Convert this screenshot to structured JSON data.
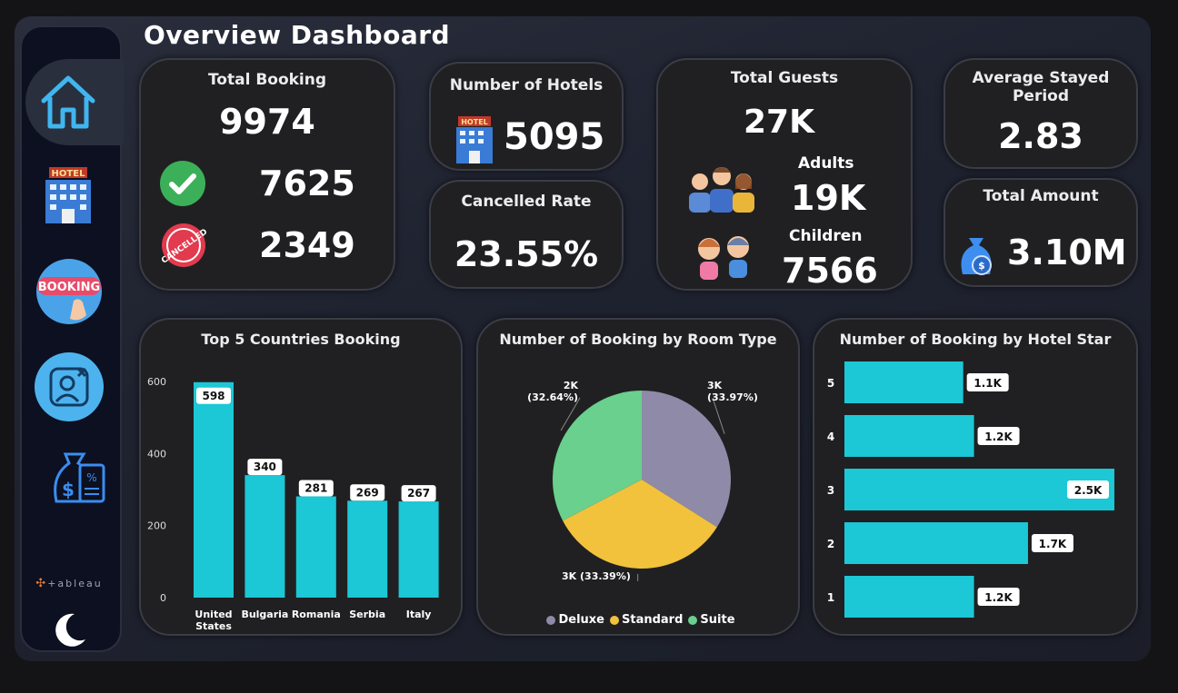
{
  "page_title": "Overview Dashboard",
  "sidebar": {
    "items": [
      {
        "name": "home",
        "icon": "home-icon"
      },
      {
        "name": "hotel",
        "icon": "hotel-icon",
        "label": "HOTEL"
      },
      {
        "name": "booking",
        "icon": "booking-icon",
        "label": "BOOKING"
      },
      {
        "name": "guest",
        "icon": "guest-cancel-icon"
      },
      {
        "name": "finance",
        "icon": "money-bag-receipt-icon"
      }
    ],
    "tableau_label": "+ableau",
    "theme_icon": "moon-icon"
  },
  "kpis": {
    "total_booking": {
      "title": "Total Booking",
      "value": "9974",
      "confirmed": "7625",
      "cancelled": "2349",
      "cancelled_stamp": "CANCELLED"
    },
    "hotels": {
      "title": "Number of Hotels",
      "value": "5095",
      "icon_label": "HOTEL"
    },
    "cancelled_rate": {
      "title": "Cancelled Rate",
      "value": "23.55%"
    },
    "guests": {
      "title": "Total Guests",
      "value": "27K",
      "adults_label": "Adults",
      "adults_value": "19K",
      "children_label": "Children",
      "children_value": "7566"
    },
    "avg_stay": {
      "title": "Average Stayed Period",
      "value": "2.83"
    },
    "total_amount": {
      "title": "Total Amount",
      "value": "3.10M"
    }
  },
  "colors": {
    "accent": "#1cc7d6",
    "deluxe": "#8e8aa8",
    "standard": "#f2c23c",
    "suite": "#69d08d",
    "card": "#202022"
  },
  "chart_data": [
    {
      "type": "bar",
      "title": "Top 5 Countries Booking",
      "categories": [
        "United States",
        "Bulgaria",
        "Romania",
        "Serbia",
        "Italy"
      ],
      "values": [
        598,
        340,
        281,
        269,
        267
      ],
      "ylim": [
        0,
        600
      ],
      "yticks": [
        "0",
        "200",
        "400",
        "600"
      ],
      "grid": false
    },
    {
      "type": "pie",
      "title": "Number of Booking by Room Type",
      "slices": [
        {
          "name": "Deluxe",
          "label": "3K",
          "pct": 33.97,
          "pct_label": "(33.97%)"
        },
        {
          "name": "Standard",
          "label": "3K",
          "pct": 33.39,
          "pct_label": "(33.39%)"
        },
        {
          "name": "Suite",
          "label": "2K",
          "pct": 32.64,
          "pct_label": "(32.64%)"
        }
      ],
      "legend": "bottom"
    },
    {
      "type": "bar",
      "orientation": "horizontal",
      "title": "Number of Booking by Hotel Star",
      "categories": [
        "5",
        "4",
        "3",
        "2",
        "1"
      ],
      "values": [
        1100,
        1200,
        2500,
        1700,
        1200
      ],
      "labels": [
        "1.1K",
        "1.2K",
        "2.5K",
        "1.7K",
        "1.2K"
      ],
      "xlim": [
        0,
        2500
      ]
    }
  ]
}
